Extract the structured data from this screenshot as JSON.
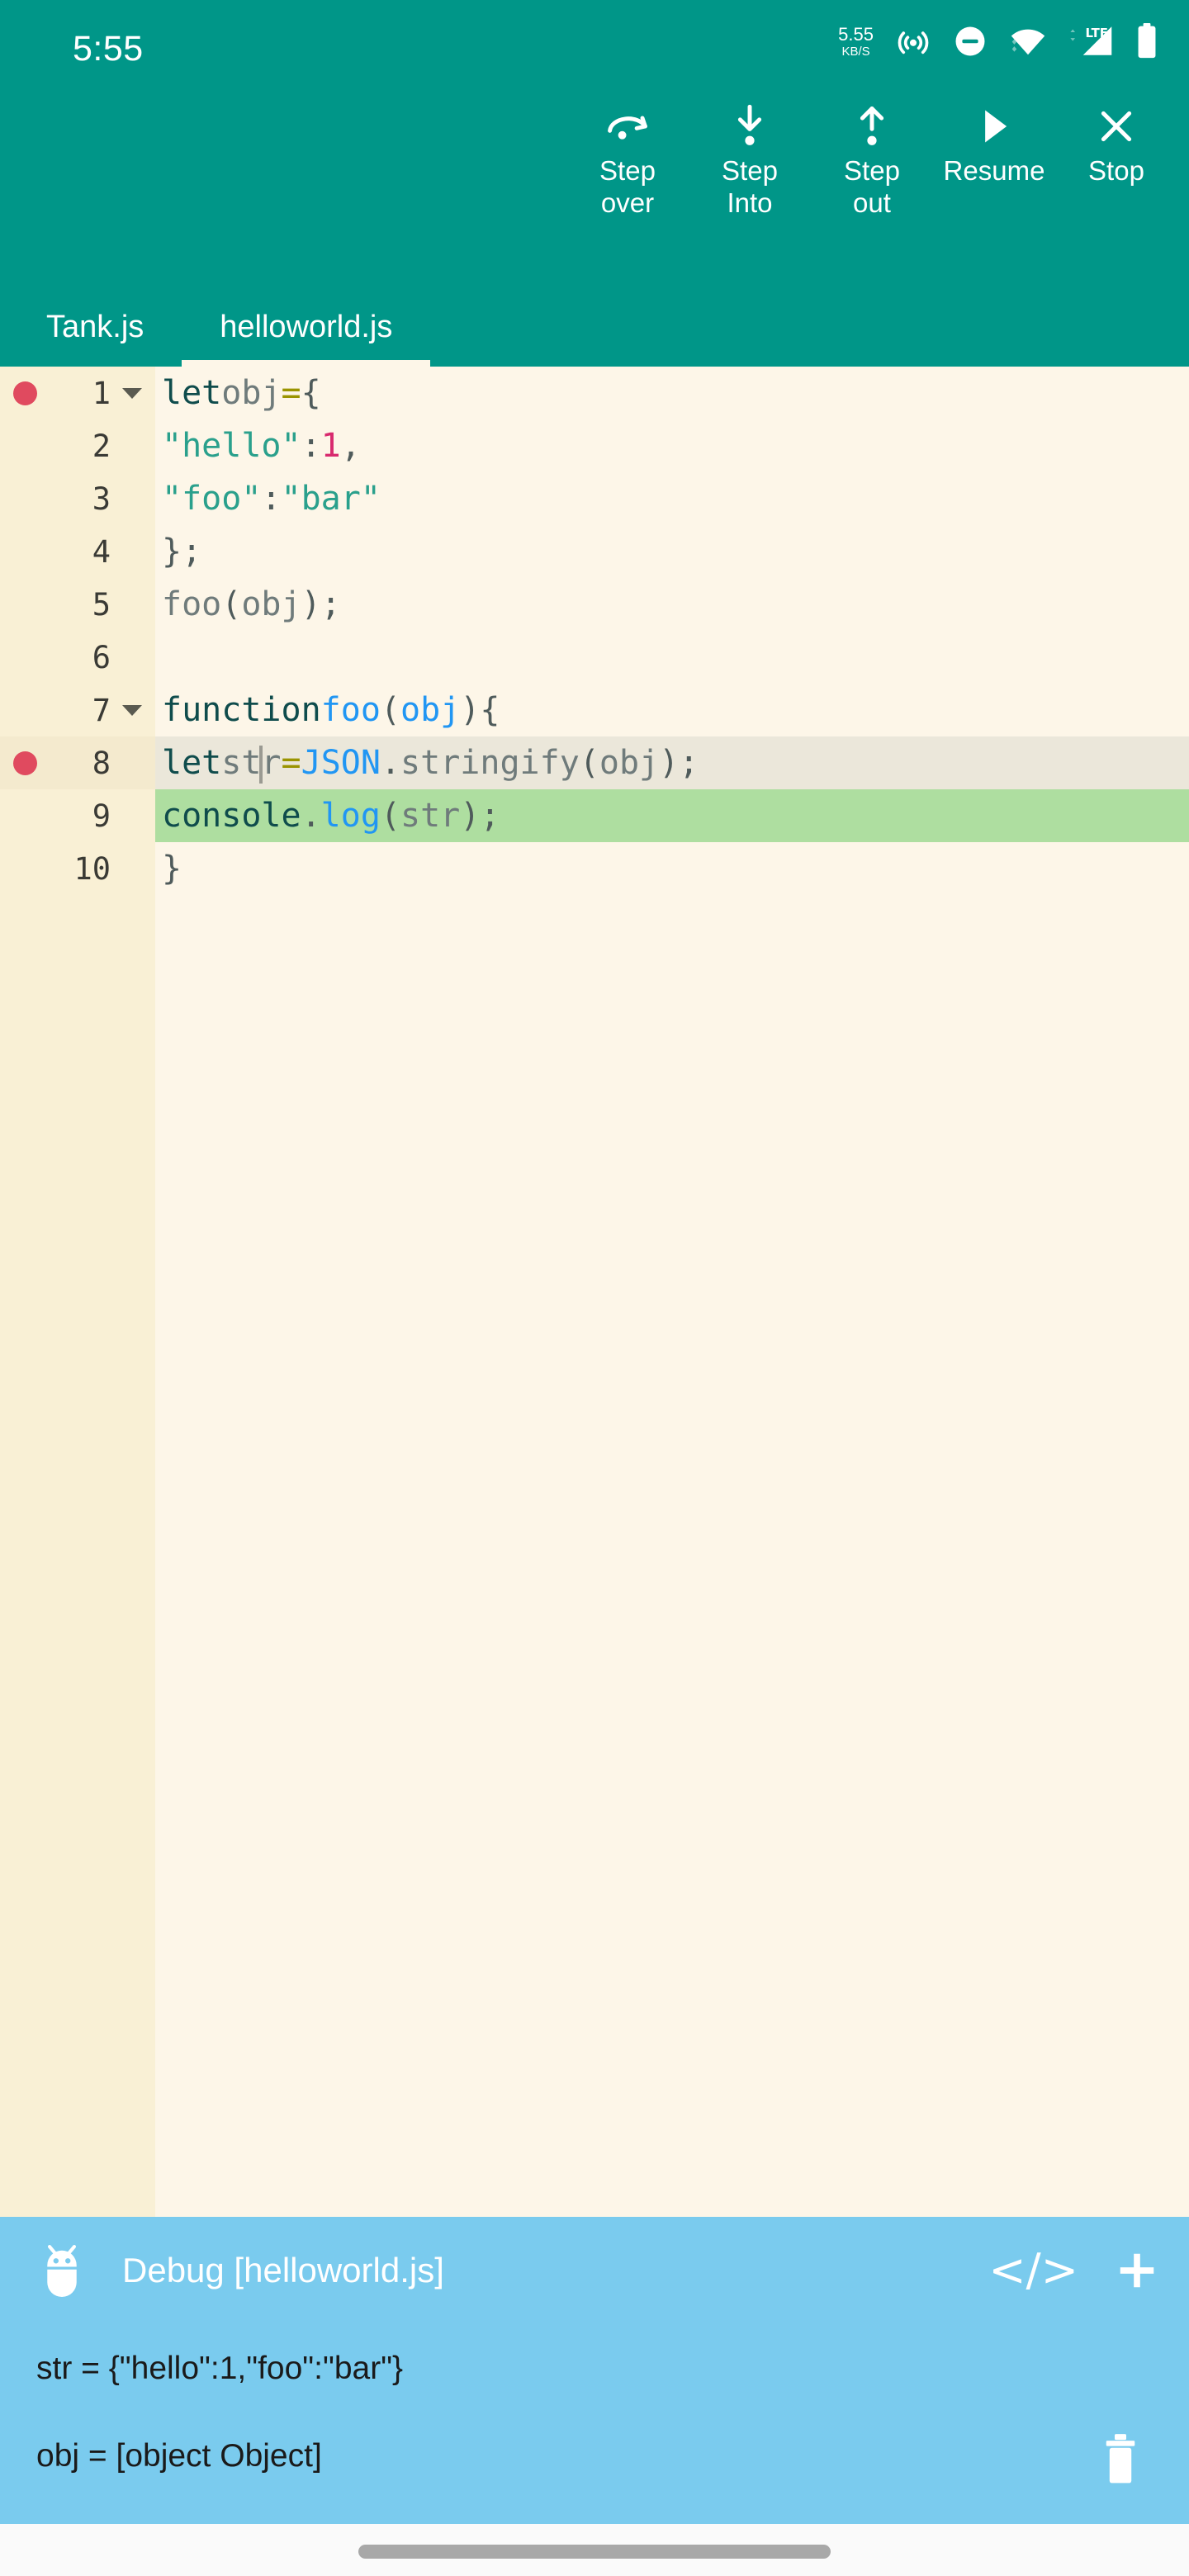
{
  "statusbar": {
    "time": "5:55",
    "net_speed_value": "5.55",
    "net_speed_unit": "KB/S",
    "icons": [
      "hotspot-icon",
      "do-not-disturb-icon",
      "wifi-icon",
      "lte-signal-icon",
      "battery-icon"
    ],
    "signal_label": "LTE"
  },
  "toolbar": {
    "buttons": [
      {
        "label": "Step\nover",
        "icon": "step-over-icon"
      },
      {
        "label": "Step\nInto",
        "icon": "step-into-icon"
      },
      {
        "label": "Step\nout",
        "icon": "step-out-icon"
      },
      {
        "label": "Resume",
        "icon": "resume-play-icon"
      },
      {
        "label": "Stop",
        "icon": "stop-close-icon"
      }
    ]
  },
  "tabs": [
    {
      "label": "Tank.js",
      "active": false
    },
    {
      "label": "helloworld.js",
      "active": true
    }
  ],
  "editor": {
    "filename": "helloworld.js",
    "lines": [
      {
        "n": "1",
        "fold": true,
        "breakpoint": true,
        "text": "let obj = {"
      },
      {
        "n": "2",
        "fold": false,
        "breakpoint": false,
        "text": "    \"hello\": 1,"
      },
      {
        "n": "3",
        "fold": false,
        "breakpoint": false,
        "text": "    \"foo\": \"bar\""
      },
      {
        "n": "4",
        "fold": false,
        "breakpoint": false,
        "text": "};"
      },
      {
        "n": "5",
        "fold": false,
        "breakpoint": false,
        "text": "foo(obj);"
      },
      {
        "n": "6",
        "fold": false,
        "breakpoint": false,
        "text": ""
      },
      {
        "n": "7",
        "fold": true,
        "breakpoint": false,
        "text": "function foo(obj) {"
      },
      {
        "n": "8",
        "fold": false,
        "breakpoint": true,
        "text": "    let str = JSON.stringify(obj);"
      },
      {
        "n": "9",
        "fold": false,
        "breakpoint": false,
        "text": "    console.log(str);"
      },
      {
        "n": "10",
        "fold": false,
        "breakpoint": false,
        "text": "}"
      }
    ],
    "current_execution_line": "9",
    "cursor_line": "8",
    "cursor_column_after": "str"
  },
  "debug": {
    "title": "Debug [helloworld.js]",
    "icon": "android-bug-icon",
    "actions": [
      {
        "label": "</>",
        "name": "code-icon"
      },
      {
        "label": "+",
        "name": "add-icon"
      }
    ],
    "variables": [
      {
        "text": "str = {\"hello\":1,\"foo\":\"bar\"}"
      },
      {
        "text": "obj = [object Object]"
      }
    ],
    "delete_icon": "trash-icon"
  },
  "colors": {
    "header_teal": "#009688",
    "editor_bg": "#FDF6E8",
    "gutter_bg": "#F9F0D5",
    "exec_line_green": "#AEDEA0",
    "cursor_line_gray": "#EBE7DA",
    "breakpoint_red": "#E04A5F",
    "debug_panel_blue": "#7ACBEE",
    "string_teal": "#2AA08C",
    "number_magenta": "#D82A6E",
    "function_blue": "#2196F3",
    "operator_olive": "#9A9400"
  }
}
